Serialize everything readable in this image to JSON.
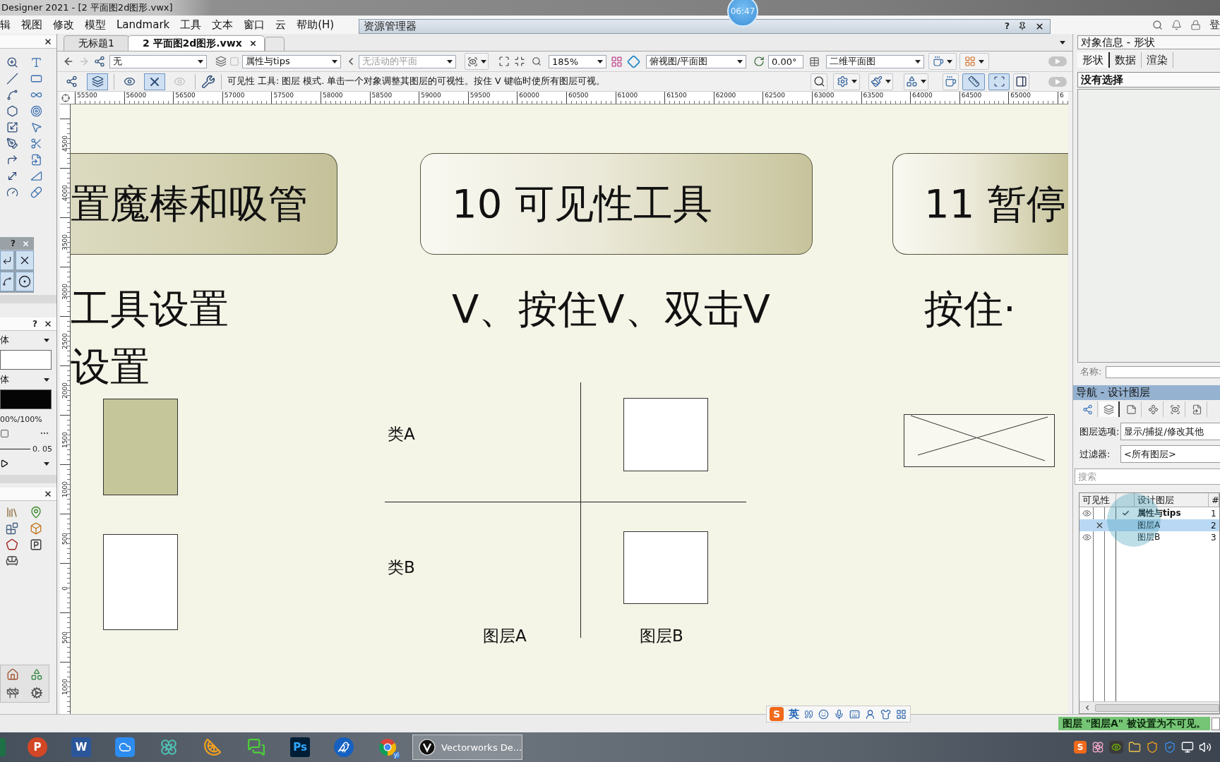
{
  "title_bar": {
    "title": "Designer 2021 - [2 平面图2d图形.vwx]"
  },
  "recording_timer": {
    "time": "06:47"
  },
  "menu_bar": {
    "items": [
      "辑",
      "视图",
      "修改",
      "模型",
      "Landmark",
      "工具",
      "文本",
      "窗口",
      "云",
      "帮助(H)"
    ],
    "account_label": "登"
  },
  "resource_manager": {
    "title": "资源管理器",
    "help": "?"
  },
  "tool_palette": {
    "floating_help": "?",
    "attributes": {
      "help": "?",
      "fill_style": "体",
      "pen_style": "体",
      "opacity": "00%/100%",
      "line_weight": "0. 05"
    }
  },
  "document_tabs": [
    {
      "label": "无标题1",
      "selected": false
    },
    {
      "label": "2 平面图2d图形.vwx",
      "selected": true
    }
  ],
  "view_bar": {
    "class": "无",
    "layer": "属性与tips",
    "plane": {
      "value": "无活动的平面",
      "disabled": true
    },
    "zoom": "185%",
    "view": "俯视图/平面图",
    "rotation": "0.00°",
    "render": "二维平面图"
  },
  "mode_bar": {
    "modes": [
      {
        "kind": "tree",
        "selected": false,
        "disabled": false
      },
      {
        "kind": "layers",
        "selected": true,
        "disabled": false
      },
      {
        "kind": "eye",
        "selected": false,
        "disabled": false
      },
      {
        "kind": "cross",
        "selected": true,
        "disabled": false
      },
      {
        "kind": "eye",
        "selected": false,
        "disabled": true
      }
    ],
    "help_text": "可见性 工具: 图层 模式. 单击一个对象调整其图层的可视性。按住 V 键临时使所有图层可视。",
    "tools": [
      {
        "kind": "magnifier",
        "selected": false,
        "menu": false
      },
      {
        "kind": "gear",
        "selected": false,
        "menu": true
      },
      {
        "kind": "brush",
        "selected": false,
        "menu": true
      },
      {
        "kind": "shapes",
        "selected": false,
        "menu": true
      },
      {
        "kind": "cup",
        "selected": false,
        "menu": false
      },
      {
        "kind": "ruler",
        "selected": true,
        "menu": false
      },
      {
        "kind": "frame",
        "selected": true,
        "menu": false
      },
      {
        "kind": "panel",
        "selected": false,
        "menu": false
      }
    ]
  },
  "rulers": {
    "horizontal": [
      "55500",
      "56000",
      "56500",
      "57000",
      "57500",
      "58000",
      "58500",
      "59000",
      "59500",
      "60000",
      "60500",
      "61000",
      "61500",
      "62000",
      "62500",
      "63000",
      "63500",
      "64000",
      "64500",
      "65000",
      "6"
    ],
    "vertical": [
      "4500",
      "4000",
      "3500",
      "3000",
      "2500",
      "2000",
      "1500",
      "1000",
      "500",
      "0",
      "500",
      "1000"
    ]
  },
  "canvas": {
    "slides": [
      {
        "title": "置魔棒和吸管",
        "lines": [
          "工具设置",
          "设置"
        ]
      },
      {
        "title": "10 可见性工具",
        "lines": [
          "V、按住V、双击V"
        ],
        "diagram": {
          "row_labels": [
            "类A",
            "类B"
          ],
          "column_labels": [
            "图层A",
            "图层B"
          ]
        }
      },
      {
        "title": "11 暂停",
        "lines": [
          "按住·"
        ]
      }
    ]
  },
  "object_info": {
    "title": "对象信息 - 形状",
    "tabs": [
      {
        "label": "形状",
        "selected": true
      },
      {
        "label": "数据",
        "selected": false
      },
      {
        "label": "渲染",
        "selected": false
      }
    ],
    "selection": "没有选择",
    "name_label": "名称:"
  },
  "navigation": {
    "title": "导航 - 设计图层",
    "tabs": [
      {
        "kind": "classes",
        "selected": false
      },
      {
        "kind": "layers",
        "selected": true
      },
      {
        "kind": "sheets",
        "selected": false
      },
      {
        "kind": "viewports",
        "selected": false
      },
      {
        "kind": "views",
        "selected": false
      },
      {
        "kind": "references",
        "selected": false
      }
    ],
    "layer_options": {
      "label": "图层选项:",
      "value": "显示/捕捉/修改其他"
    },
    "filter": {
      "label": "过滤器:",
      "value": "<所有图层>"
    },
    "search": {
      "placeholder": "搜索"
    },
    "table": {
      "columns": [
        "可见性",
        "设计图层",
        "#"
      ],
      "rows": [
        {
          "hidden": false,
          "active": true,
          "name": "属性与tips",
          "number": "1",
          "selected": false
        },
        {
          "hidden": true,
          "active": false,
          "name": "图层A",
          "number": "2",
          "selected": true
        },
        {
          "hidden": false,
          "active": false,
          "name": "图层B",
          "number": "3",
          "selected": false
        }
      ]
    }
  },
  "status_bar": {
    "message": "图层 \"图层A\" 被设置为不可见。"
  },
  "ime_bar": {
    "logo": "S",
    "mode": "英"
  },
  "taskbar": {
    "apps": [
      {
        "kind": "spreadsheet"
      },
      {
        "kind": "presentation",
        "label": "P"
      },
      {
        "kind": "document",
        "label": "W"
      },
      {
        "kind": "cloud"
      },
      {
        "kind": "pinwheel"
      },
      {
        "kind": "fruit"
      },
      {
        "kind": "chat"
      },
      {
        "kind": "photo-editor",
        "label": "Ps"
      },
      {
        "kind": "bird"
      },
      {
        "kind": "browser",
        "label": "yl"
      }
    ],
    "window": {
      "label": "Vectorworks De...",
      "selected": true
    },
    "tray": {
      "logo": "S"
    }
  }
}
